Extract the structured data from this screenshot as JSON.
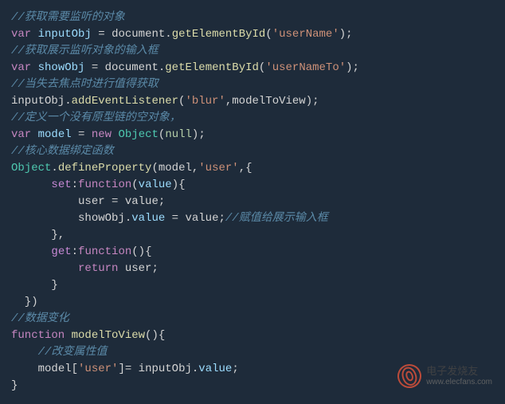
{
  "comments": {
    "c1": "//获取需要监听的对象",
    "c2": "//获取展示监听对象的输入框",
    "c3": "//当失去焦点时进行值得获取",
    "c4": "//定义一个没有原型链的空对象，",
    "c5": "//核心数据绑定函数",
    "c6": "//赋值给展示输入框",
    "c7": "//数据变化",
    "c8": "//改变属性值"
  },
  "tokens": {
    "var": "var",
    "new": "new",
    "function": "function",
    "return": "return",
    "null": "null"
  },
  "identifiers": {
    "inputObj": "inputObj",
    "showObj": "showObj",
    "document": "document",
    "model": "model",
    "Object": "Object",
    "user": "user",
    "value": "value",
    "modelToView": "modelToView"
  },
  "methods": {
    "getElementById": "getElementById",
    "addEventListener": "addEventListener",
    "defineProperty": "defineProperty",
    "set": "set",
    "get": "get"
  },
  "strings": {
    "userName": "'userName'",
    "userNameTo": "'userNameTo'",
    "blur": "'blur'",
    "userLit": "'user'"
  },
  "watermark": {
    "name": "电子发烧友",
    "url": "www.elecfans.com"
  }
}
